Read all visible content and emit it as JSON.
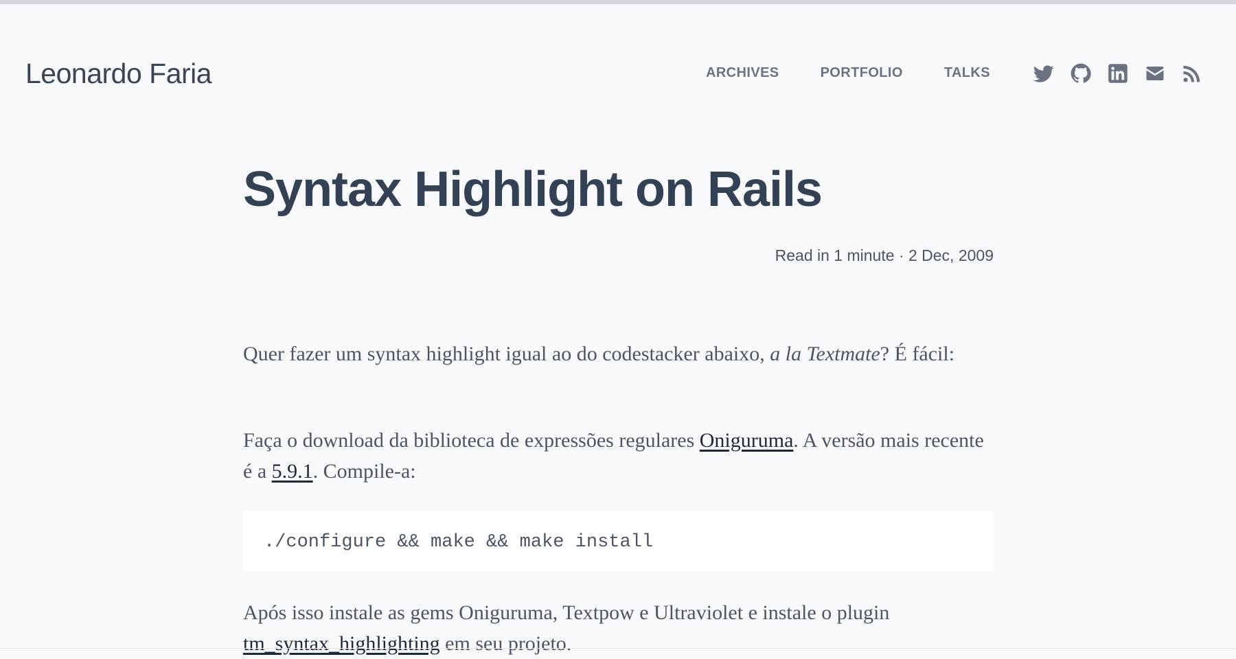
{
  "site": {
    "brand": "Leonardo Faria",
    "nav": [
      {
        "label": "ARCHIVES"
      },
      {
        "label": "PORTFOLIO"
      },
      {
        "label": "TALKS"
      }
    ],
    "social_icons": [
      "twitter-icon",
      "github-icon",
      "linkedin-icon",
      "email-icon",
      "rss-icon"
    ]
  },
  "post": {
    "title": "Syntax Highlight on Rails",
    "meta": "Read in 1 minute · 2 Dec, 2009",
    "p1": {
      "text_before": "Quer fazer um syntax highlight igual ao do codestacker abaixo, ",
      "italic": "a la Textmate",
      "text_after": "? É fácil:"
    },
    "p2": {
      "text_before": "Faça o download da biblioteca de expressões regulares ",
      "link1": "Oniguruma",
      "text_middle": ". A versão mais recente é a ",
      "link2": "5.9.1",
      "text_after": ". Compile-a:"
    },
    "code": "./configure && make && make install",
    "p3": {
      "text_before": "Após isso instale as gems Oniguruma, Textpow e Ultraviolet e instale o plugin ",
      "link": "tm_syntax_highlighting",
      "text_after": " em seu projeto."
    }
  },
  "colors": {
    "background": "#f8f9fb",
    "heading": "#334155",
    "text": "#4b5563",
    "nav": "#6b7280",
    "code_bg": "#ffffff"
  }
}
